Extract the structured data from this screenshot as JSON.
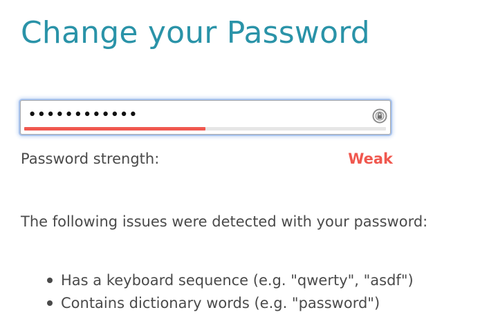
{
  "page": {
    "title": "Change your Password"
  },
  "password_field": {
    "masked_value": "••••••••••••",
    "strength_fraction": 0.5,
    "toggle_icon": "lock-eye-icon"
  },
  "strength": {
    "label": "Password strength:",
    "value": "Weak",
    "color": "#f0584f"
  },
  "issues": {
    "intro": "The following issues were detected with your password:",
    "items": [
      "Has a keyboard sequence (e.g. \"qwerty\", \"asdf\")",
      "Contains dictionary words (e.g. \"password\")"
    ]
  },
  "colors": {
    "title": "#2a93a8",
    "text": "#4a4a4a",
    "focus_ring": "#a9c4ee"
  }
}
